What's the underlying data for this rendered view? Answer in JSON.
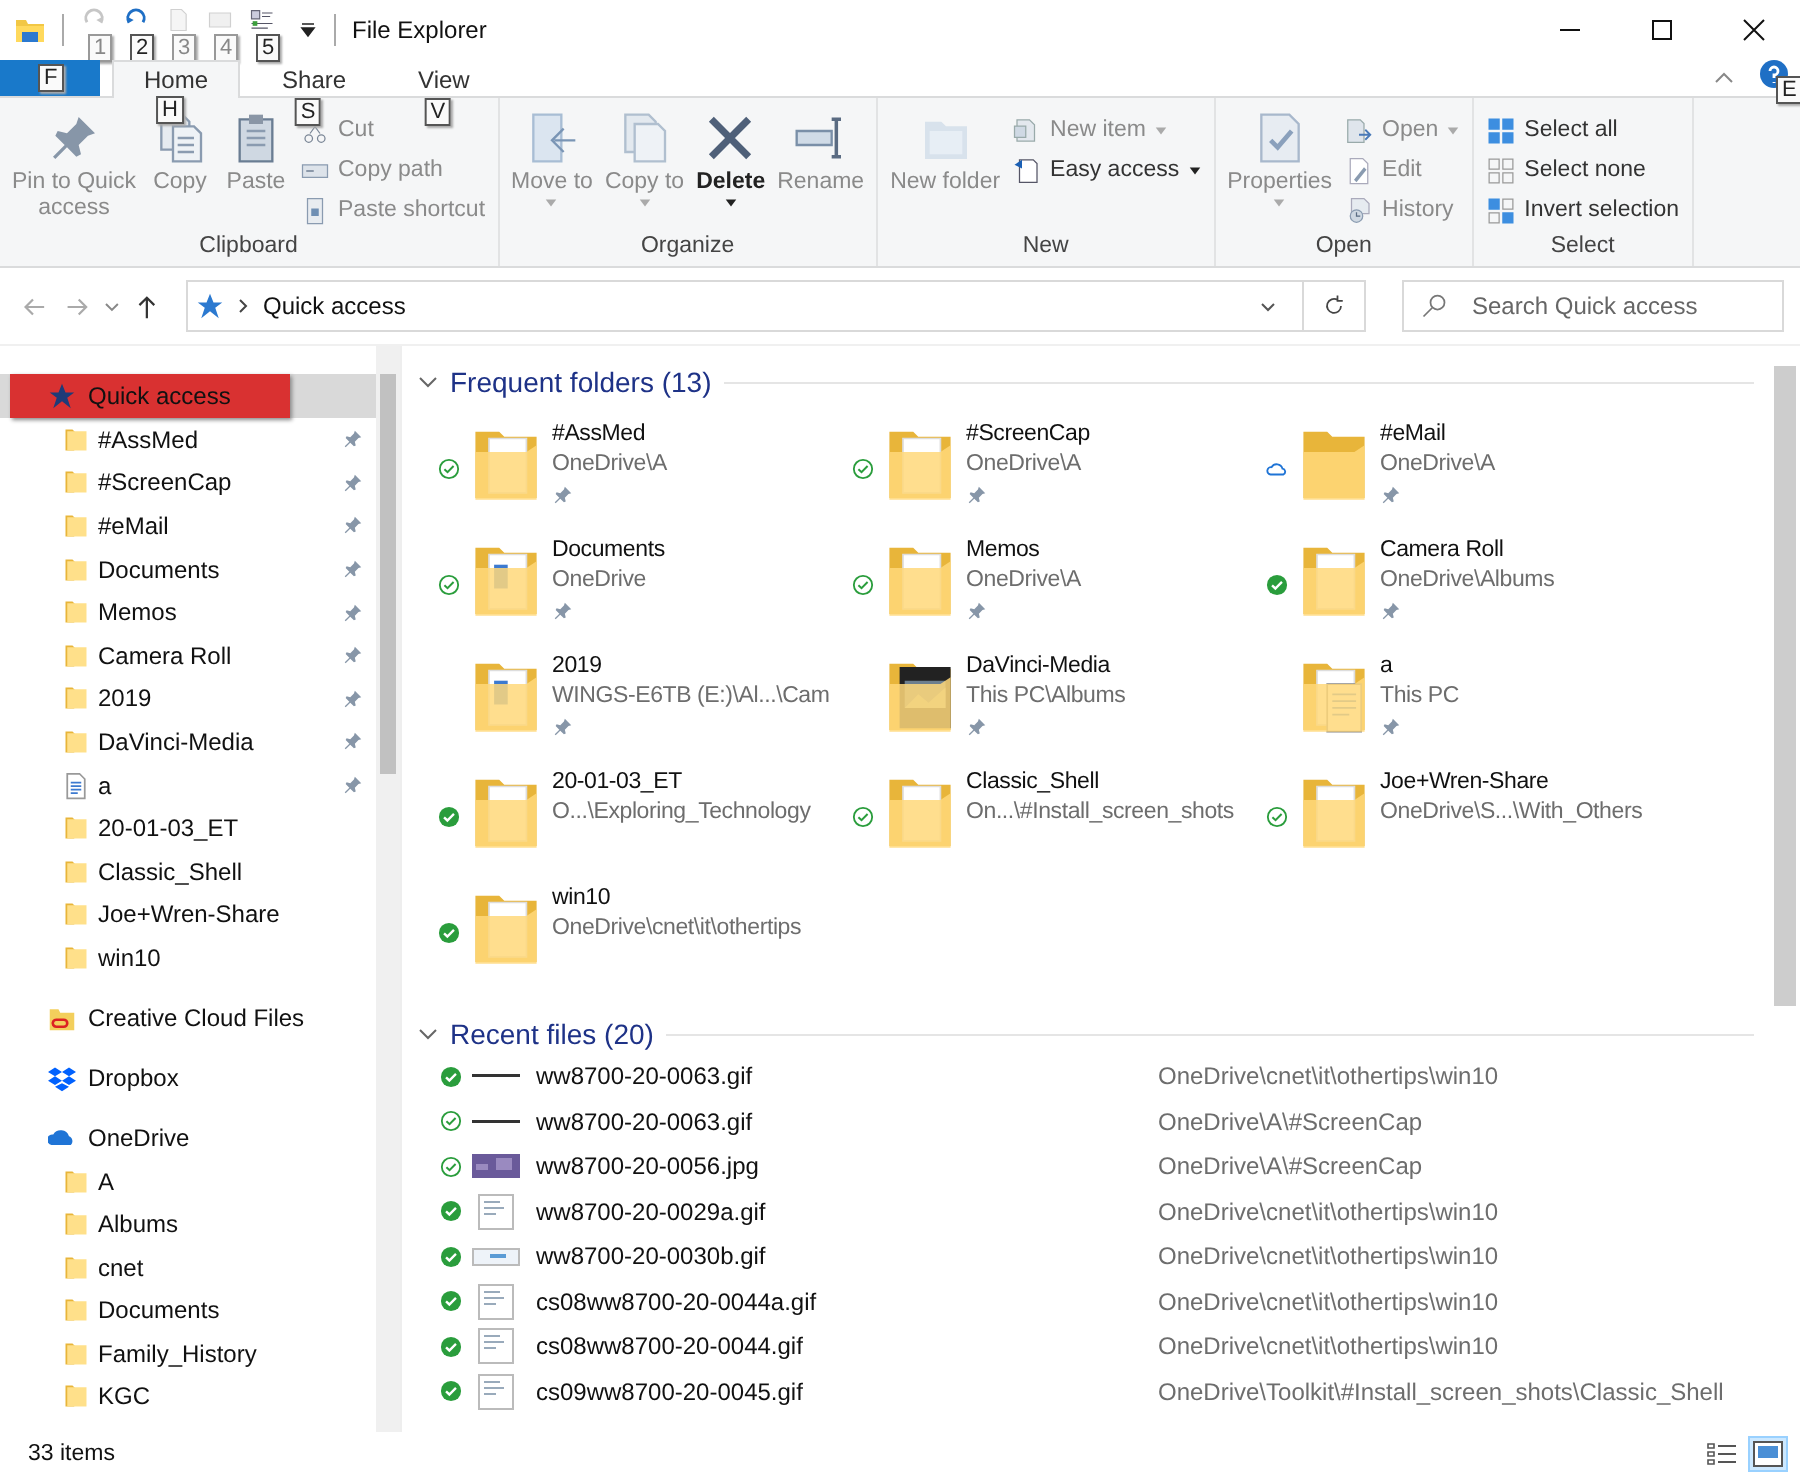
{
  "window": {
    "title": "File Explorer"
  },
  "quick_access_toolbar": [
    {
      "kind": "redo",
      "keytip": "1",
      "disabled": true
    },
    {
      "kind": "undo",
      "keytip": "2",
      "disabled": false
    },
    {
      "kind": "page",
      "keytip": "3",
      "disabled": true
    },
    {
      "kind": "panel",
      "keytip": "4",
      "disabled": true
    },
    {
      "kind": "list",
      "keytip": "5",
      "disabled": false
    }
  ],
  "file_tab": {
    "keytip": "F"
  },
  "tabs": [
    {
      "label": "Home",
      "keytip": "H",
      "selected": true
    },
    {
      "label": "Share",
      "keytip": "S",
      "selected": false
    },
    {
      "label": "View",
      "keytip": "V",
      "selected": false
    }
  ],
  "help": {
    "keytip": "E"
  },
  "ribbon": [
    {
      "label": "Clipboard",
      "large": [
        {
          "label": "Pin to Quick access",
          "kind": "pin",
          "disabled": true,
          "dropdown": false
        },
        {
          "label": "Copy",
          "kind": "copy",
          "disabled": true,
          "dropdown": false
        },
        {
          "label": "Paste",
          "kind": "paste",
          "disabled": true,
          "dropdown": false
        }
      ],
      "small": [
        {
          "label": "Cut",
          "kind": "scissors",
          "disabled": true,
          "dropdown": false
        },
        {
          "label": "Copy path",
          "kind": "copy-path",
          "disabled": true,
          "dropdown": false
        },
        {
          "label": "Paste shortcut",
          "kind": "shortcut",
          "disabled": true,
          "dropdown": false
        }
      ]
    },
    {
      "label": "Organize",
      "large": [
        {
          "label": "Move to",
          "kind": "move",
          "disabled": true,
          "dropdown": true
        },
        {
          "label": "Copy to",
          "kind": "copy-to",
          "disabled": true,
          "dropdown": true
        },
        {
          "label": "Delete",
          "kind": "delete",
          "disabled": false,
          "dropdown": true
        },
        {
          "label": "Rename",
          "kind": "rename",
          "disabled": true,
          "dropdown": false
        }
      ]
    },
    {
      "label": "New",
      "large": [
        {
          "label": "New folder",
          "kind": "new-folder",
          "disabled": true,
          "dropdown": false
        }
      ],
      "small": [
        {
          "label": "New item",
          "kind": "new-item",
          "disabled": true,
          "dropdown": true
        },
        {
          "label": "Easy access",
          "kind": "easy-access",
          "disabled": false,
          "dropdown": true
        }
      ]
    },
    {
      "label": "Open",
      "large": [
        {
          "label": "Properties",
          "kind": "properties",
          "disabled": true,
          "dropdown": true
        }
      ],
      "small": [
        {
          "label": "Open",
          "kind": "open",
          "disabled": true,
          "dropdown": true
        },
        {
          "label": "Edit",
          "kind": "edit",
          "disabled": true,
          "dropdown": false
        },
        {
          "label": "History",
          "kind": "history",
          "disabled": true,
          "dropdown": false
        }
      ]
    },
    {
      "label": "Select",
      "small": [
        {
          "label": "Select all",
          "kind": "select-all",
          "disabled": false,
          "dropdown": false
        },
        {
          "label": "Select none",
          "kind": "select-none",
          "disabled": false,
          "dropdown": false
        },
        {
          "label": "Invert selection",
          "kind": "invert",
          "disabled": false,
          "dropdown": false
        }
      ]
    }
  ],
  "address_bar": {
    "path": "Quick access"
  },
  "search": {
    "placeholder": "Search Quick access"
  },
  "navigation": [
    {
      "label": "Quick access",
      "kind": "star",
      "selected": true,
      "highlighted": true,
      "children": [
        {
          "label": "#AssMed",
          "kind": "folder",
          "pinned": true,
          "selected": false
        },
        {
          "label": "#ScreenCap",
          "kind": "folder",
          "pinned": true,
          "selected": false
        },
        {
          "label": "#eMail",
          "kind": "folder",
          "pinned": true,
          "selected": false
        },
        {
          "label": "Documents",
          "kind": "folder",
          "pinned": true,
          "selected": false
        },
        {
          "label": "Memos",
          "kind": "folder",
          "pinned": true,
          "selected": false
        },
        {
          "label": "Camera Roll",
          "kind": "folder",
          "pinned": true,
          "selected": false
        },
        {
          "label": "2019",
          "kind": "folder",
          "pinned": true,
          "selected": false
        },
        {
          "label": "DaVinci-Media",
          "kind": "folder",
          "pinned": true,
          "selected": false
        },
        {
          "label": "a",
          "kind": "document",
          "pinned": true,
          "selected": false
        },
        {
          "label": "20-01-03_ET",
          "kind": "folder",
          "pinned": false,
          "selected": false
        },
        {
          "label": "Classic_Shell",
          "kind": "folder",
          "pinned": false,
          "selected": false
        },
        {
          "label": "Joe+Wren-Share",
          "kind": "folder",
          "pinned": false,
          "selected": false
        },
        {
          "label": "win10",
          "kind": "folder",
          "pinned": false,
          "selected": false
        }
      ]
    },
    {
      "label": "Creative Cloud Files",
      "kind": "creative-cloud",
      "selected": false,
      "highlighted": false
    },
    {
      "label": "Dropbox",
      "kind": "dropbox",
      "selected": false,
      "highlighted": false
    },
    {
      "label": "OneDrive",
      "kind": "onedrive",
      "selected": false,
      "highlighted": false,
      "children": [
        {
          "label": "A",
          "kind": "folder",
          "selected": false
        },
        {
          "label": "Albums",
          "kind": "folder",
          "selected": false
        },
        {
          "label": "cnet",
          "kind": "folder",
          "selected": false
        },
        {
          "label": "Documents",
          "kind": "folder",
          "selected": false
        },
        {
          "label": "Family_History",
          "kind": "folder",
          "selected": false
        },
        {
          "label": "KGC",
          "kind": "folder",
          "selected": false
        }
      ]
    }
  ],
  "frequent_folders": {
    "title": "Frequent folders (13)",
    "items": [
      {
        "name": "#AssMed",
        "path": "OneDrive\\A",
        "status": {
          "kind": "available"
        },
        "kind": "folder",
        "pinned": true
      },
      {
        "name": "#ScreenCap",
        "path": "OneDrive\\A",
        "status": {
          "kind": "available"
        },
        "kind": "folder",
        "pinned": true
      },
      {
        "name": "#eMail",
        "path": "OneDrive\\A",
        "status": {
          "kind": "cloud"
        },
        "kind": "empty",
        "pinned": true
      },
      {
        "name": "Documents",
        "path": "OneDrive",
        "status": {
          "kind": "available"
        },
        "kind": "docs",
        "pinned": true
      },
      {
        "name": "Memos",
        "path": "OneDrive\\A",
        "status": {
          "kind": "available"
        },
        "kind": "folder",
        "pinned": true
      },
      {
        "name": "Camera Roll",
        "path": "OneDrive\\Albums",
        "status": {
          "kind": "synced"
        },
        "kind": "folder",
        "pinned": true
      },
      {
        "name": "2019",
        "path": "WINGS-E6TB (E:)\\Al...\\Cam",
        "kind": "docs",
        "pinned": true
      },
      {
        "name": "DaVinci-Media",
        "path": "This PC\\Albums",
        "kind": "media",
        "pinned": true
      },
      {
        "name": "a",
        "path": "This PC",
        "kind": "document",
        "pinned": true
      },
      {
        "name": "20-01-03_ET",
        "path": "O...\\Exploring_Technology",
        "status": {
          "kind": "synced"
        },
        "kind": "folder",
        "pinned": false
      },
      {
        "name": "Classic_Shell",
        "path": "On...\\#Install_screen_shots",
        "status": {
          "kind": "available"
        },
        "kind": "folder",
        "pinned": false
      },
      {
        "name": "Joe+Wren-Share",
        "path": "OneDrive\\S...\\With_Others",
        "status": {
          "kind": "available"
        },
        "kind": "folder",
        "pinned": false
      },
      {
        "name": "win10",
        "path": "OneDrive\\cnet\\it\\othertips",
        "status": {
          "kind": "synced"
        },
        "kind": "folder",
        "pinned": false
      }
    ]
  },
  "recent_files": {
    "title": "Recent files (20)",
    "items": [
      {
        "name": "ww8700-20-0063.gif",
        "path": "OneDrive\\cnet\\it\\othertips\\win10",
        "status": {
          "kind": "synced"
        },
        "kind": "line"
      },
      {
        "name": "ww8700-20-0063.gif",
        "path": "OneDrive\\A\\#ScreenCap",
        "status": {
          "kind": "available"
        },
        "kind": "line"
      },
      {
        "name": "ww8700-20-0056.jpg",
        "path": "OneDrive\\A\\#ScreenCap",
        "status": {
          "kind": "available"
        },
        "kind": "photo"
      },
      {
        "name": "ww8700-20-0029a.gif",
        "path": "OneDrive\\cnet\\it\\othertips\\win10",
        "status": {
          "kind": "synced"
        },
        "kind": "doc"
      },
      {
        "name": "ww8700-20-0030b.gif",
        "path": "OneDrive\\cnet\\it\\othertips\\win10",
        "status": {
          "kind": "synced"
        },
        "kind": "banner"
      },
      {
        "name": "cs08ww8700-20-0044a.gif",
        "path": "OneDrive\\cnet\\it\\othertips\\win10",
        "status": {
          "kind": "synced"
        },
        "kind": "doc"
      },
      {
        "name": "cs08ww8700-20-0044.gif",
        "path": "OneDrive\\cnet\\it\\othertips\\win10",
        "status": {
          "kind": "synced"
        },
        "kind": "doc"
      },
      {
        "name": "cs09ww8700-20-0045.gif",
        "path": "OneDrive\\Toolkit\\#Install_screen_shots\\Classic_Shell",
        "status": {
          "kind": "synced"
        },
        "kind": "doc"
      }
    ]
  },
  "status_bar": {
    "text": "33 items",
    "views": [
      {
        "kind": "details",
        "selected": false
      },
      {
        "kind": "large-icons",
        "selected": true
      }
    ]
  }
}
